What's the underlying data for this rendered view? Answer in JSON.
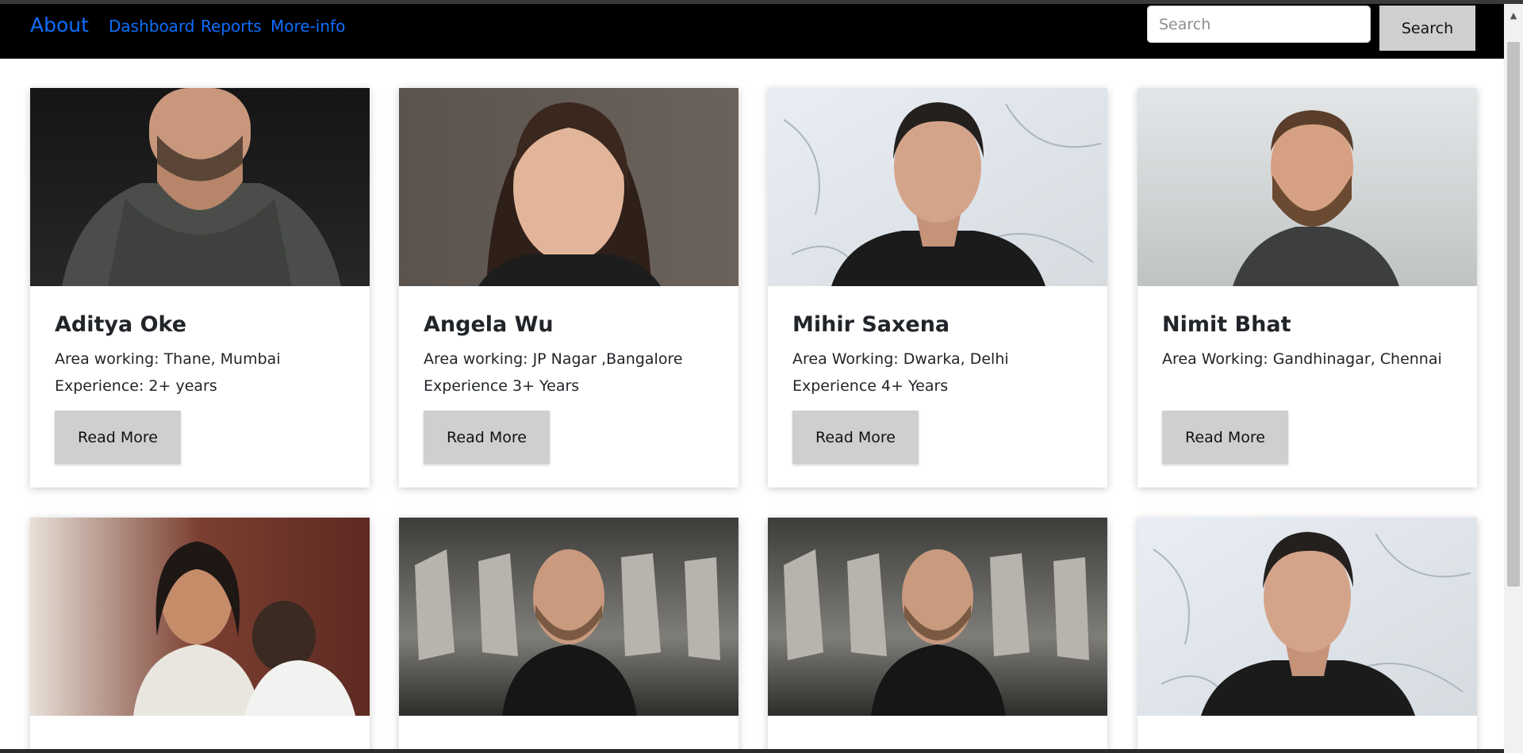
{
  "nav": {
    "brand": "About",
    "links": [
      "Dashboard",
      "Reports",
      "More-info"
    ],
    "search_placeholder": "Search",
    "search_button": "Search"
  },
  "cards": [
    {
      "name": "Aditya Oke",
      "line1": "Area working: Thane, Mumbai",
      "line2": "Experience: 2+ years",
      "button": "Read More"
    },
    {
      "name": "Angela Wu",
      "line1": "Area working: JP Nagar ,Bangalore",
      "line2": "Experience 3+ Years",
      "button": "Read More"
    },
    {
      "name": "Mihir Saxena",
      "line1": "Area Working: Dwarka, Delhi",
      "line2": "Experience 4+ Years",
      "button": "Read More"
    },
    {
      "name": "Nimit Bhat",
      "line1": "Area Working: Gandhinagar, Chennai",
      "line2": "",
      "button": "Read More"
    }
  ],
  "colors": {
    "nav_background": "#000000",
    "link": "#0d6efd",
    "button_background": "#cfcfcf"
  }
}
